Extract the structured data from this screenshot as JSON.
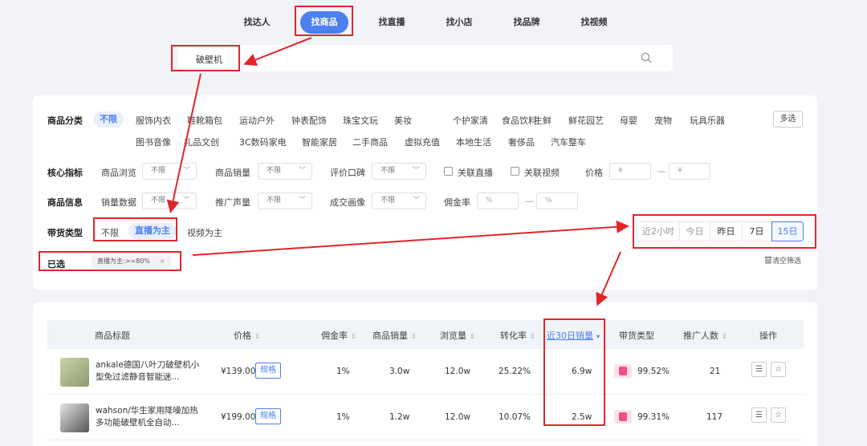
{
  "nav": {
    "tabs": [
      {
        "label": "找达人"
      },
      {
        "label": "找商品"
      },
      {
        "label": "找直播"
      },
      {
        "label": "找小店"
      },
      {
        "label": "找品牌"
      },
      {
        "label": "找视频"
      }
    ],
    "active_index": 1
  },
  "search": {
    "value": "破壁机"
  },
  "filters": {
    "category": {
      "label": "商品分类",
      "selected": "不限",
      "row1": [
        "服饰内衣",
        "鞋靴箱包",
        "运动户外",
        "钟表配饰",
        "珠宝文玩",
        "美妆",
        "个护家清",
        "食品饮料",
        "生鲜",
        "鲜花园艺",
        "母婴",
        "宠物",
        "玩具乐器"
      ],
      "row2": [
        "图书音像",
        "礼品文创",
        "3C数码家电",
        "智能家居",
        "二手商品",
        "虚拟充值",
        "本地生活",
        "奢侈品",
        "汽车整车"
      ],
      "multi_label": "多选"
    },
    "core": {
      "label": "核心指标",
      "browse": {
        "label": "商品浏览",
        "value": "不限"
      },
      "sales": {
        "label": "商品销量",
        "value": "不限"
      },
      "review": {
        "label": "评价口碑",
        "value": "不限"
      },
      "live_label": "关联直播",
      "video_label": "关联视频",
      "price_label": "价格",
      "price_min_ph": "¥",
      "price_max_ph": "¥"
    },
    "info": {
      "label": "商品信息",
      "sales_data": {
        "label": "销量数据",
        "value": "不限"
      },
      "promo": {
        "label": "推广声量",
        "value": "不限"
      },
      "deal": {
        "label": "成交画像",
        "value": "不限"
      },
      "commission_label": "佣金率",
      "commission_min_ph": "%",
      "commission_max_ph": "%"
    },
    "sell_type": {
      "label": "带货类型",
      "options": [
        "不限",
        "直播为主",
        "视频为主"
      ],
      "selected": "直播为主"
    },
    "chosen": {
      "label": "已选",
      "chip": "直播为主:>=80%",
      "close": "×"
    },
    "time": {
      "options": [
        "近2小时",
        "今日",
        "昨日",
        "7日",
        "15日"
      ],
      "selected": "15日"
    },
    "clear_label": "清空筛选",
    "trash_icon": "trash-icon"
  },
  "table": {
    "headers": [
      "商品标题",
      "价格",
      "佣金率",
      "商品销量",
      "浏览量",
      "转化率",
      "近30日销量",
      "带货类型",
      "推广人数",
      "操作"
    ],
    "sorted_column": "近30日销量",
    "rows": [
      {
        "title": "ankale德国八叶刀破壁机小型免过滤静音智能迷...",
        "price": "¥139.00",
        "spec": "规格",
        "commission": "1%",
        "sales": "3.0w",
        "views": "12.0w",
        "conversion": "25.22%",
        "sales30": "6.9w",
        "live_pct": "99.52%",
        "promoters": "21"
      },
      {
        "title": "wahson/华生家用降噪加热多功能破壁机全自动...",
        "price": "¥199.00",
        "spec": "规格",
        "commission": "1%",
        "sales": "1.2w",
        "views": "12.0w",
        "conversion": "10.07%",
        "sales30": "2.5w",
        "live_pct": "99.31%",
        "promoters": "117"
      }
    ]
  },
  "colors": {
    "accent": "#4c7ff0",
    "annotation_red": "#e0262a",
    "live_pink": "#f04e86"
  }
}
